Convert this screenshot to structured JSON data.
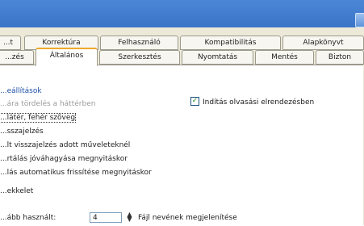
{
  "tabs_back": [
    "...t",
    "Korrektúra",
    "Felhasználó",
    "Kompatibilitás",
    "Alapkönyvt"
  ],
  "tabs_front": [
    "...zés",
    "Általános",
    "Szerkesztés",
    "Nyomtatás",
    "Mentés",
    "Bizton"
  ],
  "options": {
    "group_title": "...eállítások",
    "background_repagination": "...ára tördelés a háttérben",
    "blue_background": "...látér, fehér szöveg",
    "feedback_sound": "...sszajelzés",
    "feedback_animation": "...lt visszajelzés adott műveleteknél",
    "confirm_conversion": "...rtálás jóváhagyása megnyitáskor",
    "auto_update_links": "...lás automatikus frissítése megnyitáskor",
    "web_features": "...ekkelet",
    "recent_files_label": "...ább használt:",
    "recent_files_value": "4",
    "recent_files_suffix": "Fájl nevének megjelenítése",
    "startup_checkbox": "Indítás olvasási elrendezésben"
  }
}
